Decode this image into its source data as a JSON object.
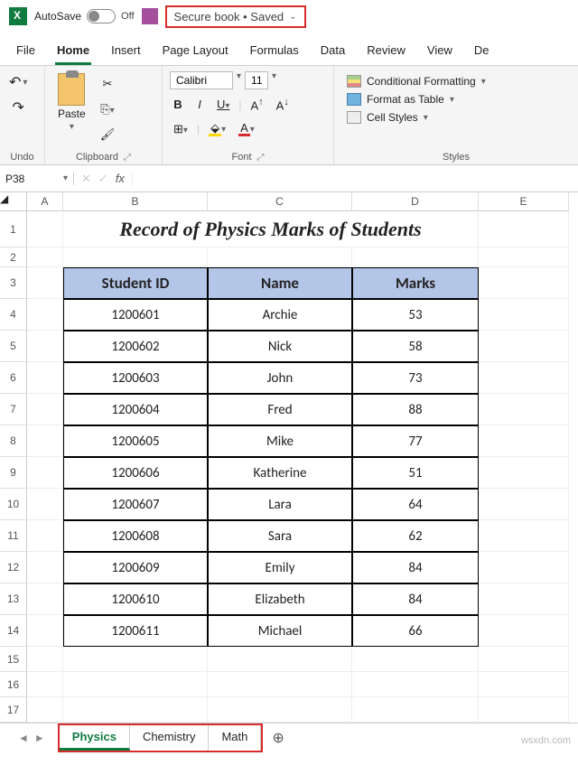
{
  "titlebar": {
    "autosave_label": "AutoSave",
    "autosave_state": "Off",
    "file_name": "Secure book • Saved"
  },
  "menu": {
    "tabs": [
      "File",
      "Home",
      "Insert",
      "Page Layout",
      "Formulas",
      "Data",
      "Review",
      "View",
      "De"
    ],
    "active": "Home"
  },
  "ribbon": {
    "undo_label": "Undo",
    "clipboard_label": "Clipboard",
    "paste_label": "Paste",
    "font_label": "Font",
    "font_name": "Calibri",
    "font_size": "11",
    "styles_label": "Styles",
    "cond_fmt": "Conditional Formatting",
    "fmt_table": "Format as Table",
    "cell_styles": "Cell Styles"
  },
  "formula": {
    "name_box": "P38",
    "fx_value": ""
  },
  "columns": [
    "A",
    "B",
    "C",
    "D",
    "E"
  ],
  "sheet": {
    "title": "Record of Physics Marks of Students",
    "headers": [
      "Student ID",
      "Name",
      "Marks"
    ],
    "rows": [
      {
        "id": "1200601",
        "name": "Archie",
        "marks": "53"
      },
      {
        "id": "1200602",
        "name": "Nick",
        "marks": "58"
      },
      {
        "id": "1200603",
        "name": "John",
        "marks": "73"
      },
      {
        "id": "1200604",
        "name": "Fred",
        "marks": "88"
      },
      {
        "id": "1200605",
        "name": "Mike",
        "marks": "77"
      },
      {
        "id": "1200606",
        "name": "Katherine",
        "marks": "51"
      },
      {
        "id": "1200607",
        "name": "Lara",
        "marks": "64"
      },
      {
        "id": "1200608",
        "name": "Sara",
        "marks": "62"
      },
      {
        "id": "1200609",
        "name": "Emily",
        "marks": "84"
      },
      {
        "id": "1200610",
        "name": "Elizabeth",
        "marks": "84"
      },
      {
        "id": "1200611",
        "name": "Michael",
        "marks": "66"
      }
    ]
  },
  "tabs": {
    "sheets": [
      "Physics",
      "Chemistry",
      "Math"
    ],
    "active": "Physics"
  },
  "watermark": "wsxdn.com"
}
